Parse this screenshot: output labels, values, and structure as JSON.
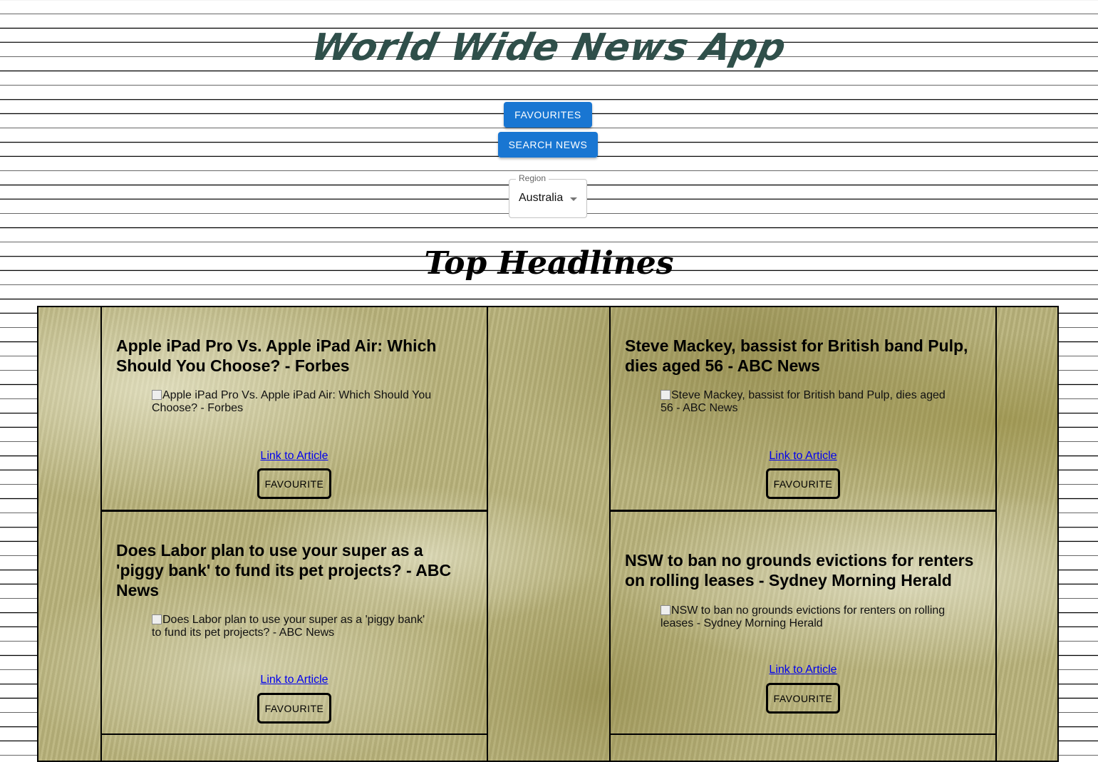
{
  "app": {
    "title": "World Wide News App"
  },
  "nav": {
    "favourites_label": "Favourites",
    "search_label": "Search News"
  },
  "region": {
    "label": "Region",
    "value": "Australia"
  },
  "headlines": {
    "title": "Top Headlines",
    "articles": [
      {
        "title": "Apple iPad Pro Vs. Apple iPad Air: Which Should You Choose? - Forbes",
        "image_alt": "Apple iPad Pro Vs. Apple iPad Air: Which Should You Choose? - Forbes",
        "link_label": "Link to Article",
        "favourite_label": "Favourite"
      },
      {
        "title": "Steve Mackey, bassist for British band Pulp, dies aged 56 - ABC News",
        "image_alt": "Steve Mackey, bassist for British band Pulp, dies aged 56 - ABC News",
        "link_label": "Link to Article",
        "favourite_label": "Favourite"
      },
      {
        "title": "Does Labor plan to use your super as a 'piggy bank' to fund its pet projects? - ABC News",
        "image_alt": "Does Labor plan to use your super as a 'piggy bank' to fund its pet projects? - ABC News",
        "link_label": "Link to Article",
        "favourite_label": "Favourite"
      },
      {
        "title": "NSW to ban no grounds evictions for renters on rolling leases - Sydney Morning Herald",
        "image_alt": "NSW to ban no grounds evictions for renters on rolling leases - Sydney Morning Herald",
        "link_label": "Link to Article",
        "favourite_label": "Favourite"
      }
    ]
  },
  "colors": {
    "title": "#2f4f4a",
    "primary_button": "#1976d2",
    "link": "#0000ee"
  }
}
